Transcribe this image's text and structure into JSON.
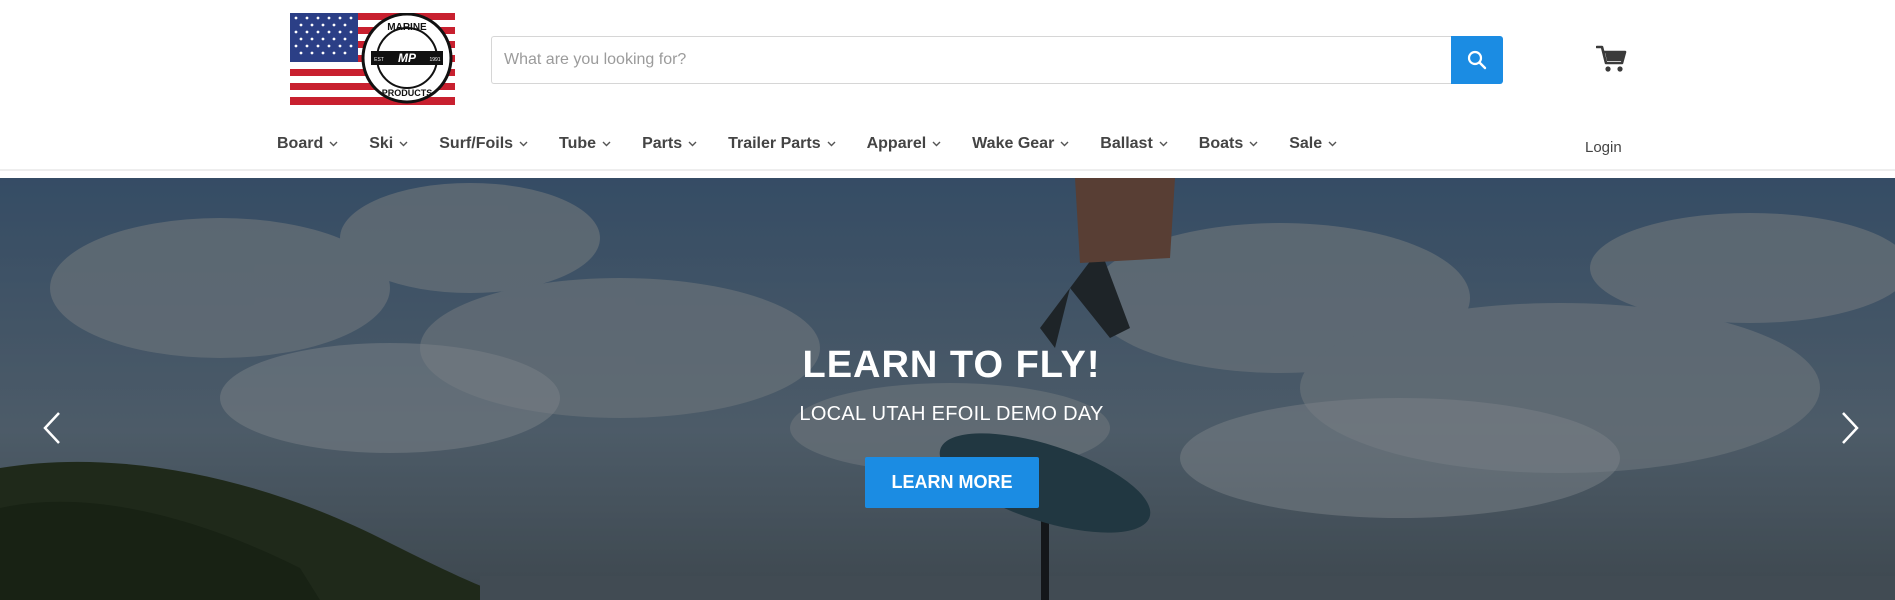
{
  "brand": {
    "logo_alt": "Marine Products",
    "logo_text_top": "MARINE",
    "logo_text_bottom": "PRODUCTS",
    "logo_monogram": "MP",
    "logo_est": "EST",
    "logo_year": "1991"
  },
  "search": {
    "placeholder": "What are you looking for?",
    "value": ""
  },
  "nav": {
    "items": [
      {
        "label": "Board"
      },
      {
        "label": "Ski"
      },
      {
        "label": "Surf/Foils"
      },
      {
        "label": "Tube"
      },
      {
        "label": "Parts"
      },
      {
        "label": "Trailer Parts"
      },
      {
        "label": "Apparel"
      },
      {
        "label": "Wake Gear"
      },
      {
        "label": "Ballast"
      },
      {
        "label": "Boats"
      },
      {
        "label": "Sale"
      }
    ],
    "login": "Login"
  },
  "hero": {
    "title": "LEARN TO FLY!",
    "subtitle": "LOCAL UTAH EFOIL DEMO DAY",
    "cta": "LEARN MORE"
  },
  "icons": {
    "search": "search-icon",
    "cart": "cart-icon",
    "chevron": "chevron-down-icon",
    "prev": "chevron-left-icon",
    "next": "chevron-right-icon"
  },
  "colors": {
    "accent": "#1b8ce3",
    "nav_text": "#444444"
  }
}
